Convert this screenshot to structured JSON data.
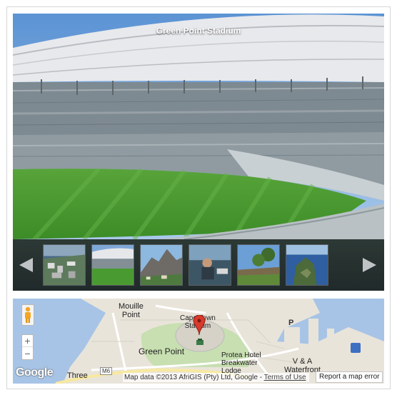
{
  "panorama": {
    "title": "Green Point Stadium"
  },
  "thumbnails": [
    {
      "label": "harbour aerial"
    },
    {
      "label": "stadium interior"
    },
    {
      "label": "table mountain"
    },
    {
      "label": "waterfront person"
    },
    {
      "label": "coastal garden"
    },
    {
      "label": "cape point coast"
    }
  ],
  "nav": {
    "prev_icon": "triangle-left",
    "next_icon": "triangle-right"
  },
  "map": {
    "labels": {
      "mouille_point": "Mouille\nPoint",
      "stadium": "Cape Town\nStadium",
      "green_point": "Green Point",
      "protea": "Protea Hotel\nBreakwater\nLodge",
      "va": "V & A\nWaterfront",
      "three": "Three",
      "p": "P",
      "m6": "M6"
    },
    "google": "Google",
    "attribution": "Map data ©2013 AfriGIS (Pty) Ltd, Google - ",
    "terms": "Terms of Use",
    "report": "Report a map error",
    "zoom_in": "+",
    "zoom_out": "−"
  },
  "colors": {
    "accent": "#d83a2c",
    "water": "#a7c4e6",
    "land": "#e8e3da"
  }
}
